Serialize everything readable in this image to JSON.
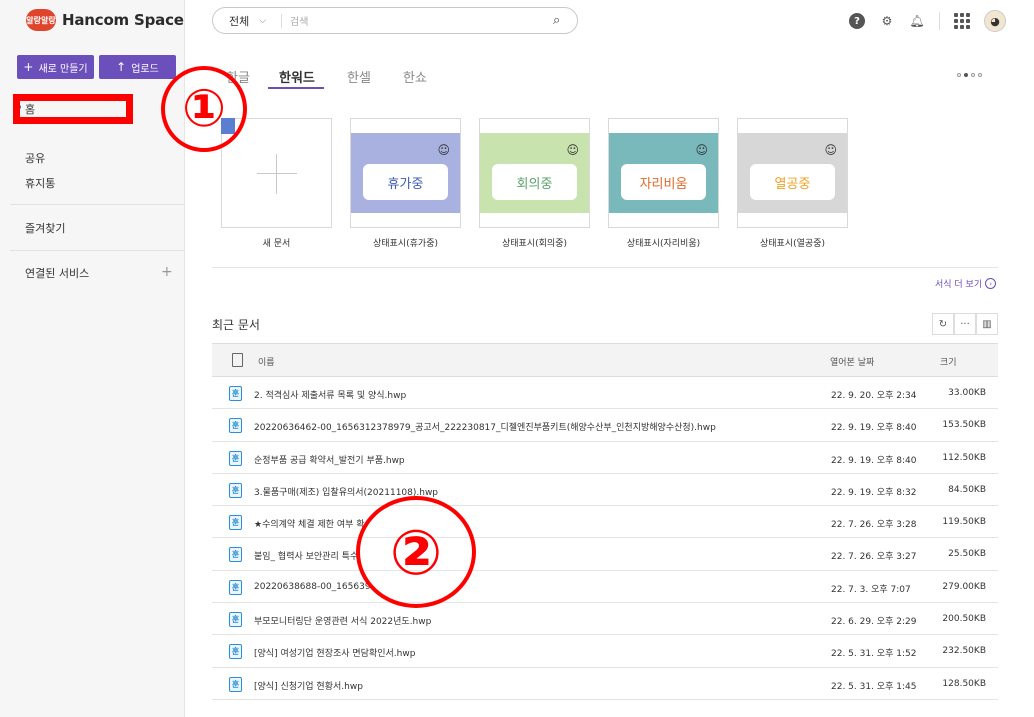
{
  "logo": {
    "badge": "알랑알랑",
    "name": "Hancom Space"
  },
  "sidebar": {
    "new_button": "새로 만들기",
    "upload_button": "업로드",
    "items": [
      "홈",
      "공유",
      "휴지통"
    ],
    "favorites": "즐겨찾기",
    "connected_services": "연결된 서비스"
  },
  "search": {
    "scope": "전체",
    "placeholder": "검색"
  },
  "tabs": [
    "한글",
    "한워드",
    "한셀",
    "한쇼"
  ],
  "templates": [
    {
      "caption": "새 문서"
    },
    {
      "label": "휴가중",
      "caption": "상태표시(휴가중)",
      "bg": "#a8b1e0",
      "fg": "#3f5bb0"
    },
    {
      "label": "회의중",
      "caption": "상태표시(회의중)",
      "bg": "#c9e3ae",
      "fg": "#59a36a"
    },
    {
      "label": "자리비움",
      "caption": "상태표시(자리비움)",
      "bg": "#79b9bc",
      "fg": "#e26a2a"
    },
    {
      "label": "열공중",
      "caption": "상태표시(열공중)",
      "bg": "#d7d7d7",
      "fg": "#f0a020"
    }
  ],
  "more_templates": "서식 더 보기",
  "recent": {
    "title": "최근 문서",
    "columns": {
      "name": "이름",
      "date": "열어본 날짜",
      "size": "크기"
    },
    "rows": [
      {
        "icon": "훈",
        "name": "2. 적격심사 제출서류 목록 및 양식.hwp",
        "date": "22. 9. 20. 오후 2:34",
        "size": "33.00KB"
      },
      {
        "icon": "훈",
        "name": "20220636462-00_1656312378979_공고서_222230817_디젤엔진부품키트(해양수산부_인천지방해양수산청).hwp",
        "date": "22. 9. 19. 오후 8:40",
        "size": "153.50KB"
      },
      {
        "icon": "훈",
        "name": "순정부품 공급 확약서_발전기 부품.hwp",
        "date": "22. 9. 19. 오후 8:40",
        "size": "112.50KB"
      },
      {
        "icon": "훈",
        "name": "3.물품구매(제조) 입찰유의서(20211108).hwp",
        "date": "22. 9. 19. 오후 8:32",
        "size": "84.50KB"
      },
      {
        "icon": "훈",
        "name": "★수의계약 체결 제한 여부 확",
        "date": "22. 7. 26. 오후 3:28",
        "size": "119.50KB"
      },
      {
        "icon": "훈",
        "name": "붙임_ 협력사 보안관리 특수",
        "date": "22. 7. 26. 오후 3:27",
        "size": "25.50KB"
      },
      {
        "icon": "훈",
        "name": "20220638688-00_165639",
        "date": "22. 7. 3. 오후 7:07",
        "size": "279.00KB"
      },
      {
        "icon": "훈",
        "name": "부모모니터링단 운영관련 서식 2022년도.hwp",
        "date": "22. 6. 29. 오후 2:29",
        "size": "200.50KB"
      },
      {
        "icon": "훈",
        "name": "[양식] 여성기업 현장조사 면담확인서.hwp",
        "date": "22. 5. 31. 오후 1:52",
        "size": "232.50KB"
      },
      {
        "icon": "훈",
        "name": "[양식] 신청기업 현황서.hwp",
        "date": "22. 5. 31. 오후 1:45",
        "size": "128.50KB"
      }
    ]
  },
  "annotations": {
    "one": "①",
    "two": "②"
  }
}
